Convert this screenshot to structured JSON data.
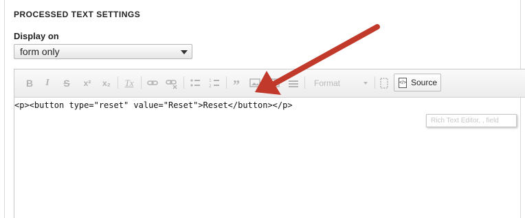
{
  "section_title": "PROCESSED TEXT SETTINGS",
  "display_on": {
    "label": "Display on",
    "selected": "form only"
  },
  "toolbar": {
    "bold": "B",
    "italic": "I",
    "strike": "S",
    "superscript": "x²",
    "subscript": "x₂",
    "remove_format": "Tx",
    "format_label": "Format",
    "source_label": "Source"
  },
  "editor": {
    "content": "<p><button type=\"reset\" value=\"Reset\">Reset</button></p>"
  },
  "tooltip": "Rich Text Editor, , field",
  "colors": {
    "annotation_arrow": "#c0392b"
  }
}
